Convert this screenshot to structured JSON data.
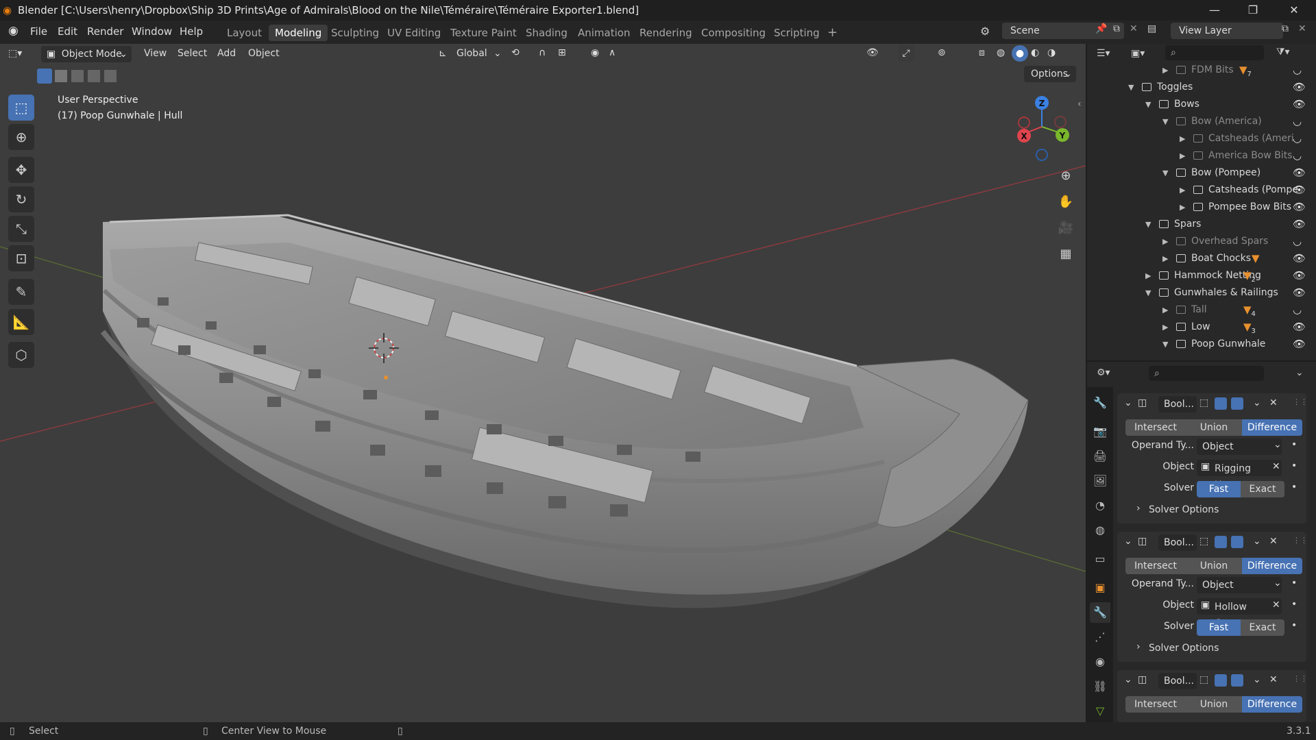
{
  "window": {
    "title": "Blender [C:\\Users\\henry\\Dropbox\\Ship 3D Prints\\Age of Admirals\\Blood on the Nile\\Téméraire\\Téméraire Exporter1.blend]",
    "minimize": "—",
    "maximize": "❐",
    "close": "✕"
  },
  "menus": [
    "File",
    "Edit",
    "Render",
    "Window",
    "Help"
  ],
  "workspaces": [
    "Layout",
    "Modeling",
    "Sculpting",
    "UV Editing",
    "Texture Paint",
    "Shading",
    "Animation",
    "Rendering",
    "Compositing",
    "Scripting",
    "+"
  ],
  "active_workspace": "Modeling",
  "scene": "Scene",
  "view_layer": "View Layer",
  "viewport_header": {
    "mode": "Object Mode",
    "menus": [
      "View",
      "Select",
      "Add",
      "Object"
    ],
    "orientation": "Global",
    "options": "Options"
  },
  "viewport": {
    "perspective": "User Perspective",
    "active_object": "(17) Poop Gunwhale | Hull",
    "gizmo": {
      "x": "X",
      "y": "Y",
      "z": "Z"
    }
  },
  "outliner": {
    "rows": [
      {
        "label": "FDM Bits",
        "depth": 3,
        "expanded": false,
        "dim": true,
        "badge": "7"
      },
      {
        "label": "Toggles",
        "depth": 1,
        "expanded": true,
        "dim": false
      },
      {
        "label": "Bows",
        "depth": 2,
        "expanded": true,
        "dim": false
      },
      {
        "label": "Bow (America)",
        "depth": 3,
        "expanded": true,
        "dim": true
      },
      {
        "label": "Catsheads (Ameri",
        "depth": 4,
        "expanded": false,
        "dim": true
      },
      {
        "label": "America Bow Bits",
        "depth": 4,
        "expanded": false,
        "dim": true
      },
      {
        "label": "Bow (Pompee)",
        "depth": 3,
        "expanded": true,
        "dim": false
      },
      {
        "label": "Catsheads (Pompe",
        "depth": 4,
        "expanded": false,
        "dim": false
      },
      {
        "label": "Pompee Bow Bits",
        "depth": 4,
        "expanded": false,
        "dim": false
      },
      {
        "label": "Spars",
        "depth": 2,
        "expanded": true,
        "dim": false
      },
      {
        "label": "Overhead Spars",
        "depth": 3,
        "expanded": false,
        "dim": true
      },
      {
        "label": "Boat Chocks",
        "depth": 3,
        "expanded": false,
        "dim": false,
        "badge": ""
      },
      {
        "label": "Hammock Netting",
        "depth": 2,
        "expanded": false,
        "dim": false,
        "badge": "2"
      },
      {
        "label": "Gunwhales & Railings",
        "depth": 2,
        "expanded": true,
        "dim": false
      },
      {
        "label": "Tall",
        "depth": 3,
        "expanded": false,
        "dim": true,
        "badge": "4"
      },
      {
        "label": "Low",
        "depth": 3,
        "expanded": false,
        "dim": false,
        "badge": "3"
      },
      {
        "label": "Poop Gunwhale",
        "depth": 3,
        "expanded": true,
        "dim": false
      }
    ]
  },
  "modifiers": [
    {
      "name": "Bool...",
      "operations": [
        "Intersect",
        "Union",
        "Difference"
      ],
      "active_op": "Difference",
      "operand_label": "Operand Ty...",
      "operand_type": "Object",
      "object_label": "Object",
      "object": "Rigging H...",
      "solver_label": "Solver",
      "solvers": [
        "Fast",
        "Exact"
      ],
      "active_solver": "Fast",
      "solver_options": "Solver Options"
    },
    {
      "name": "Bool...",
      "operations": [
        "Intersect",
        "Union",
        "Difference"
      ],
      "active_op": "Difference",
      "operand_label": "Operand Ty...",
      "operand_type": "Object",
      "object_label": "Object",
      "object": "Hollow Cr...",
      "solver_label": "Solver",
      "solvers": [
        "Fast",
        "Exact"
      ],
      "active_solver": "Fast",
      "solver_options": "Solver Options"
    },
    {
      "name": "Bool...",
      "operations": [
        "Intersect",
        "Union",
        "Difference"
      ],
      "active_op": "Difference"
    }
  ],
  "status_bar": {
    "left": "Select",
    "middle": "Center View to Mouse",
    "version": "3.3.1"
  },
  "colors": {
    "accent": "#4772b3",
    "viewport_bg": "#3d3d3d",
    "panel_bg": "#282828",
    "axis_x": "#e0444d",
    "axis_y": "#7ab72c",
    "axis_z": "#3b81e3",
    "restrict_triangle": "#e8902f"
  }
}
